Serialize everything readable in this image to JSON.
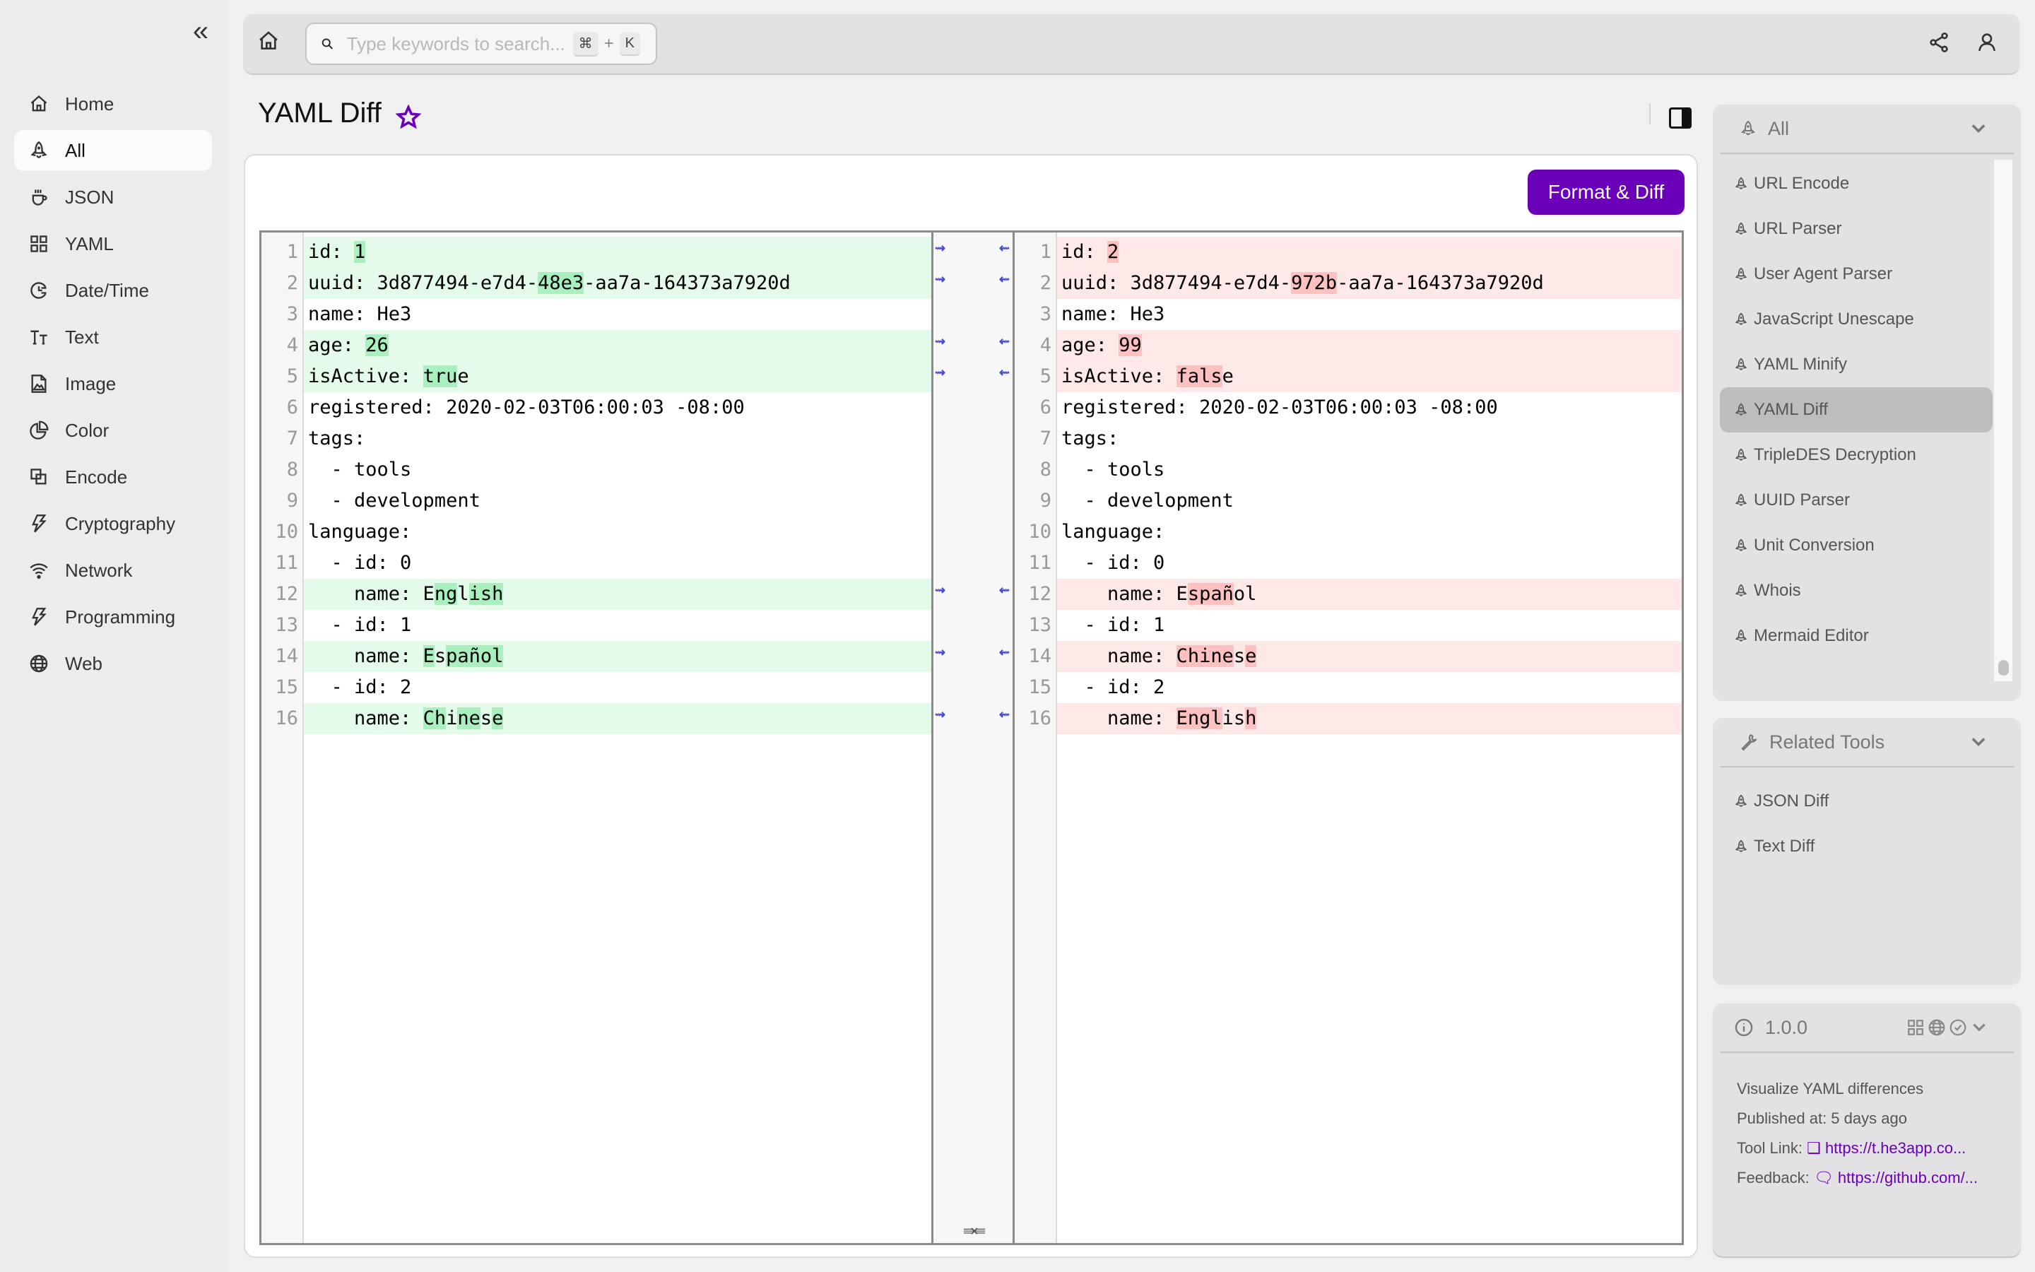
{
  "sidebar": {
    "collapse_icon": "double-chevron-left-icon",
    "items": [
      {
        "label": "Home",
        "icon": "home-icon",
        "active": false
      },
      {
        "label": "All",
        "icon": "rocket-icon",
        "active": true
      },
      {
        "label": "JSON",
        "icon": "cup-icon",
        "active": false
      },
      {
        "label": "YAML",
        "icon": "grid-icon",
        "active": false
      },
      {
        "label": "Date/Time",
        "icon": "clock-icon",
        "active": false
      },
      {
        "label": "Text",
        "icon": "text-size-icon",
        "active": false
      },
      {
        "label": "Image",
        "icon": "image-icon",
        "active": false
      },
      {
        "label": "Color",
        "icon": "pie-icon",
        "active": false
      },
      {
        "label": "Encode",
        "icon": "layers-icon",
        "active": false
      },
      {
        "label": "Cryptography",
        "icon": "lightning-icon",
        "active": false
      },
      {
        "label": "Network",
        "icon": "wifi-icon",
        "active": false
      },
      {
        "label": "Programming",
        "icon": "lightning-icon",
        "active": false
      },
      {
        "label": "Web",
        "icon": "globe-icon",
        "active": false
      }
    ]
  },
  "topbar": {
    "search_placeholder": "Type keywords to search...",
    "search_value": "",
    "shortcut_key1": "⌘",
    "shortcut_plus": "+",
    "shortcut_key2": "K"
  },
  "page": {
    "title": "YAML Diff",
    "format_button": "Format & Diff"
  },
  "diff": {
    "left": [
      {
        "n": "1",
        "changed": true,
        "parts": [
          [
            "id: ",
            0
          ],
          [
            "1",
            1
          ]
        ]
      },
      {
        "n": "2",
        "changed": true,
        "parts": [
          [
            "uuid: 3d877494-e7d4-",
            0
          ],
          [
            "48e3",
            1
          ],
          [
            "-aa7a-164373a7920d",
            0
          ]
        ]
      },
      {
        "n": "3",
        "changed": false,
        "parts": [
          [
            "name: He3",
            0
          ]
        ]
      },
      {
        "n": "4",
        "changed": true,
        "parts": [
          [
            "age: ",
            0
          ],
          [
            "26",
            1
          ]
        ]
      },
      {
        "n": "5",
        "changed": true,
        "parts": [
          [
            "isActive: ",
            0
          ],
          [
            "tru",
            1
          ],
          [
            "e",
            0
          ]
        ]
      },
      {
        "n": "6",
        "changed": false,
        "parts": [
          [
            "registered: 2020-02-03T06:00:03 -08:00",
            0
          ]
        ]
      },
      {
        "n": "7",
        "changed": false,
        "parts": [
          [
            "tags:",
            0
          ]
        ]
      },
      {
        "n": "8",
        "changed": false,
        "parts": [
          [
            "  - tools",
            0
          ]
        ]
      },
      {
        "n": "9",
        "changed": false,
        "parts": [
          [
            "  - development",
            0
          ]
        ]
      },
      {
        "n": "10",
        "changed": false,
        "parts": [
          [
            "language:",
            0
          ]
        ]
      },
      {
        "n": "11",
        "changed": false,
        "parts": [
          [
            "  - id: 0",
            0
          ]
        ]
      },
      {
        "n": "12",
        "changed": true,
        "parts": [
          [
            "    name: E",
            0
          ],
          [
            "ng",
            1
          ],
          [
            "l",
            0
          ],
          [
            "ish",
            1
          ]
        ]
      },
      {
        "n": "13",
        "changed": false,
        "parts": [
          [
            "  - id: 1",
            0
          ]
        ]
      },
      {
        "n": "14",
        "changed": true,
        "parts": [
          [
            "    name: ",
            0
          ],
          [
            "E",
            1
          ],
          [
            "s",
            0
          ],
          [
            "pañol",
            1
          ]
        ]
      },
      {
        "n": "15",
        "changed": false,
        "parts": [
          [
            "  - id: 2",
            0
          ]
        ]
      },
      {
        "n": "16",
        "changed": true,
        "parts": [
          [
            "    name: ",
            0
          ],
          [
            "Ch",
            1
          ],
          [
            "i",
            0
          ],
          [
            "ne",
            1
          ],
          [
            "s",
            0
          ],
          [
            "e",
            1
          ]
        ]
      }
    ],
    "right": [
      {
        "n": "1",
        "changed": true,
        "parts": [
          [
            "id: ",
            0
          ],
          [
            "2",
            1
          ]
        ]
      },
      {
        "n": "2",
        "changed": true,
        "parts": [
          [
            "uuid: 3d877494-e7d4-",
            0
          ],
          [
            "972b",
            1
          ],
          [
            "-aa7a-164373a7920d",
            0
          ]
        ]
      },
      {
        "n": "3",
        "changed": false,
        "parts": [
          [
            "name: He3",
            0
          ]
        ]
      },
      {
        "n": "4",
        "changed": true,
        "parts": [
          [
            "age: ",
            0
          ],
          [
            "99",
            1
          ]
        ]
      },
      {
        "n": "5",
        "changed": true,
        "parts": [
          [
            "isActive: ",
            0
          ],
          [
            "fals",
            1
          ],
          [
            "e",
            0
          ]
        ]
      },
      {
        "n": "6",
        "changed": false,
        "parts": [
          [
            "registered: 2020-02-03T06:00:03 -08:00",
            0
          ]
        ]
      },
      {
        "n": "7",
        "changed": false,
        "parts": [
          [
            "tags:",
            0
          ]
        ]
      },
      {
        "n": "8",
        "changed": false,
        "parts": [
          [
            "  - tools",
            0
          ]
        ]
      },
      {
        "n": "9",
        "changed": false,
        "parts": [
          [
            "  - development",
            0
          ]
        ]
      },
      {
        "n": "10",
        "changed": false,
        "parts": [
          [
            "language:",
            0
          ]
        ]
      },
      {
        "n": "11",
        "changed": false,
        "parts": [
          [
            "  - id: 0",
            0
          ]
        ]
      },
      {
        "n": "12",
        "changed": true,
        "parts": [
          [
            "    name: E",
            0
          ],
          [
            "spañ",
            1
          ],
          [
            "ol",
            0
          ]
        ]
      },
      {
        "n": "13",
        "changed": false,
        "parts": [
          [
            "  - id: 1",
            0
          ]
        ]
      },
      {
        "n": "14",
        "changed": true,
        "parts": [
          [
            "    name: ",
            0
          ],
          [
            "Chine",
            1
          ],
          [
            "s",
            0
          ],
          [
            "e",
            1
          ]
        ]
      },
      {
        "n": "15",
        "changed": false,
        "parts": [
          [
            "  - id: 2",
            0
          ]
        ]
      },
      {
        "n": "16",
        "changed": true,
        "parts": [
          [
            "    name: ",
            0
          ],
          [
            "Engl",
            1
          ],
          [
            "is",
            0
          ],
          [
            "h",
            1
          ]
        ]
      }
    ],
    "merge_arrow_right": "⇝",
    "merge_arrow_left": "⇜",
    "collapse_glyph": "⇛⇚"
  },
  "right_panel": {
    "category": {
      "label": "All",
      "items": [
        "URL Encode",
        "URL Parser",
        "User Agent Parser",
        "JavaScript Unescape",
        "YAML Minify",
        "YAML Diff",
        "TripleDES Decryption",
        "UUID Parser",
        "Unit Conversion",
        "Whois",
        "Mermaid Editor"
      ],
      "selected": "YAML Diff"
    },
    "related": {
      "label": "Related Tools",
      "items": [
        "JSON Diff",
        "Text Diff"
      ]
    },
    "info": {
      "version": "1.0.0",
      "description": "Visualize YAML differences",
      "published": "Published at: 5 days ago",
      "tool_link_label": "Tool Link:",
      "tool_link": "https://t.he3app.co...",
      "feedback_label": "Feedback:",
      "feedback_link": "https://github.com/..."
    }
  },
  "colors": {
    "accent": "#6a00b8",
    "added_line": "#e4fbe9",
    "added_word": "#a9f0bf",
    "removed_line": "#ffe8e8",
    "removed_word": "#ffc0c0"
  }
}
